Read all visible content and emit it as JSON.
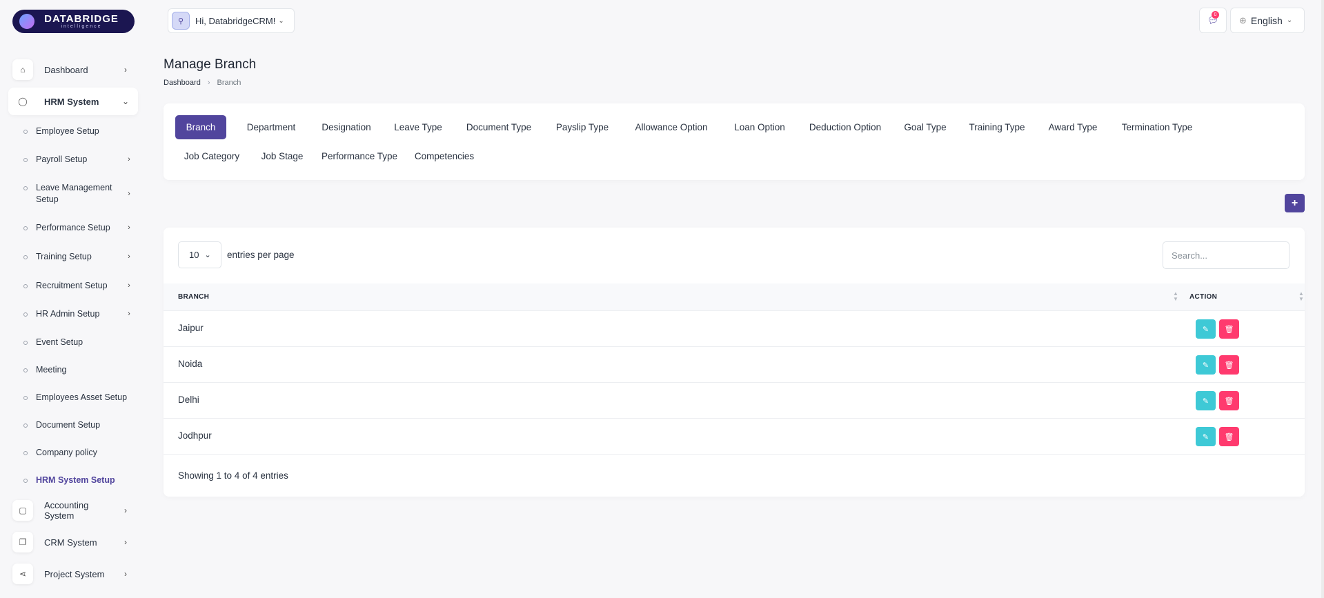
{
  "brand": {
    "title": "DATABRIDGE",
    "subtitle": "intelligence",
    "logo_icon": "databridge-logo-icon"
  },
  "header": {
    "user_greeting": "Hi, DatabridgeCRM!",
    "notifications_count": "0",
    "language": "English"
  },
  "sidebar": {
    "main_items": [
      {
        "label": "Dashboard",
        "icon": "home-icon"
      },
      {
        "label": "HRM System",
        "icon": "user-icon"
      },
      {
        "label": "Accounting System",
        "icon": "box-icon"
      },
      {
        "label": "CRM System",
        "icon": "layers-icon"
      },
      {
        "label": "Project System",
        "icon": "share-icon"
      }
    ],
    "sub_items": [
      {
        "label": "Employee Setup"
      },
      {
        "label": "Payroll Setup"
      },
      {
        "label": "Leave Management Setup"
      },
      {
        "label": "Performance Setup"
      },
      {
        "label": "Training Setup"
      },
      {
        "label": "Recruitment Setup"
      },
      {
        "label": "HR Admin Setup"
      },
      {
        "label": "Event Setup"
      },
      {
        "label": "Meeting"
      },
      {
        "label": "Employees Asset Setup"
      },
      {
        "label": "Document Setup"
      },
      {
        "label": "Company policy"
      },
      {
        "label": "HRM System Setup"
      }
    ]
  },
  "page": {
    "title": "Manage Branch",
    "breadcrumb": [
      "Dashboard",
      "Branch"
    ]
  },
  "tabs": [
    "Branch",
    "Department",
    "Designation",
    "Leave Type",
    "Document Type",
    "Payslip Type",
    "Allowance Option",
    "Loan Option",
    "Deduction Option",
    "Goal Type",
    "Training Type",
    "Award Type",
    "Termination Type",
    "Job Category",
    "Job Stage",
    "Performance Type",
    "Competencies"
  ],
  "add_button_label": "+",
  "table": {
    "per_page": "10",
    "per_page_label": "entries per page",
    "search_placeholder": "Search...",
    "columns": [
      "BRANCH",
      "ACTION"
    ],
    "rows": [
      "Jaipur",
      "Noida",
      "Delhi",
      "Jodhpur"
    ],
    "footer": "Showing 1 to 4 of 4 entries"
  },
  "colors": {
    "primary": "#51459d",
    "edit": "#3ec9d6",
    "delete": "#ff3a6e"
  }
}
